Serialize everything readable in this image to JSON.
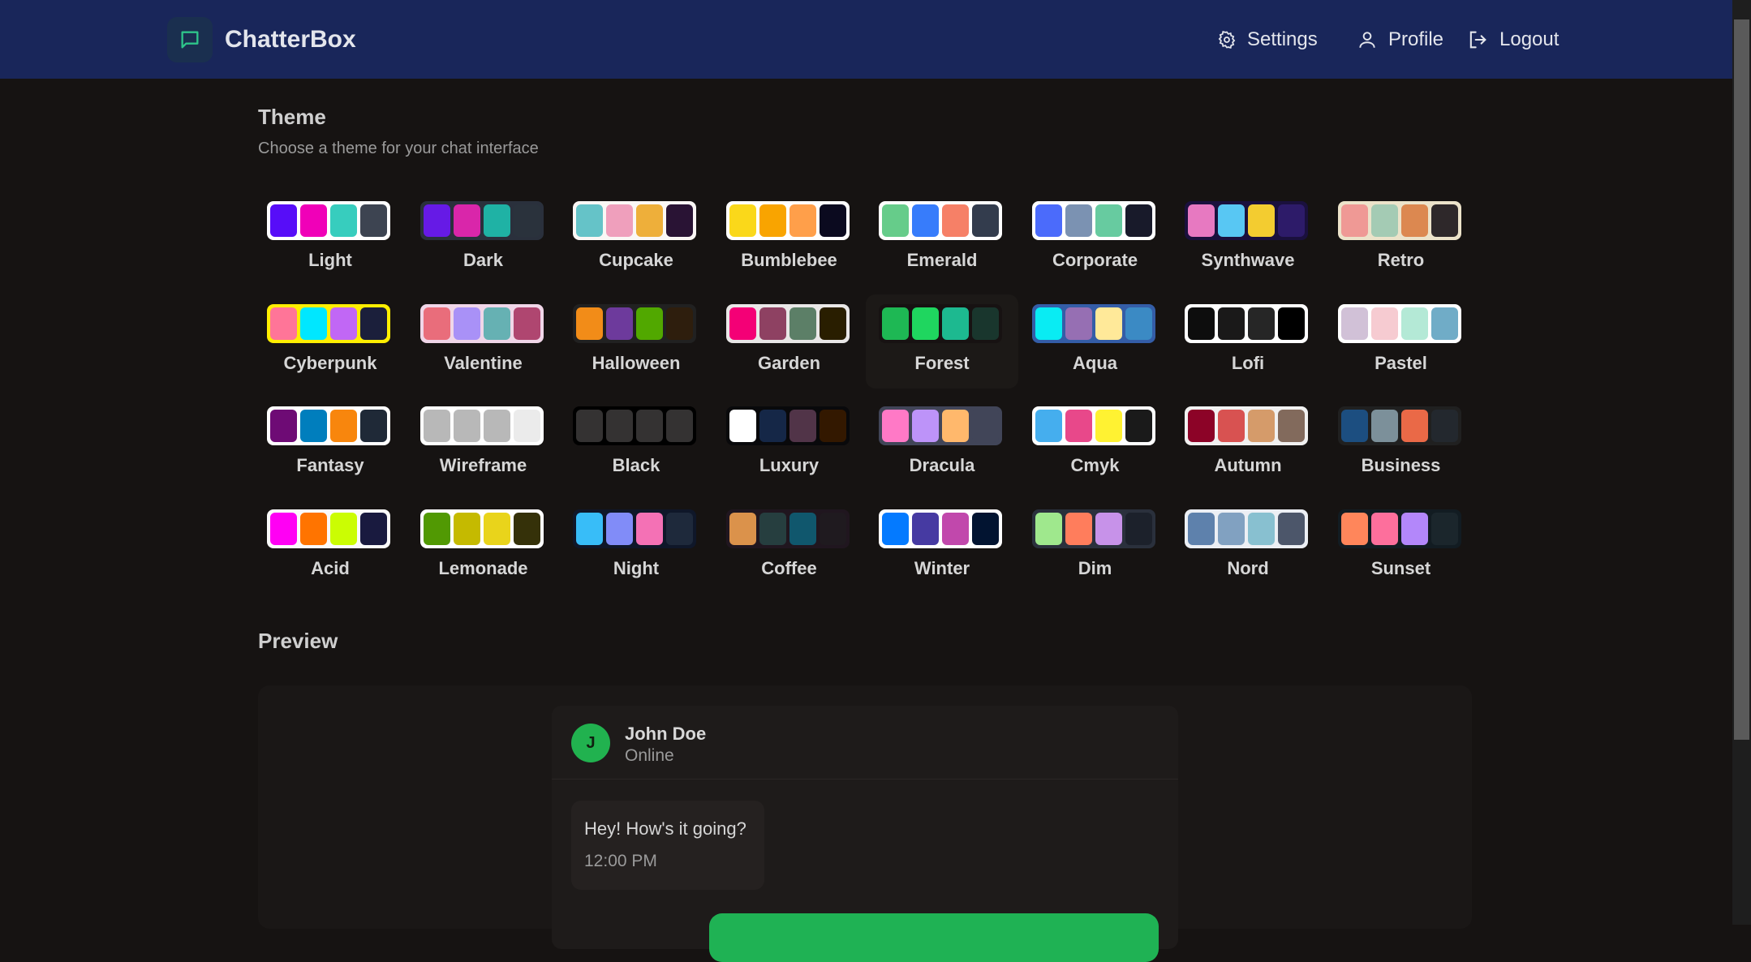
{
  "app": {
    "name": "ChatterBox",
    "accent": "#19265a"
  },
  "nav": {
    "settings": "Settings",
    "profile": "Profile",
    "logout": "Logout"
  },
  "theme_section": {
    "title": "Theme",
    "subtitle": "Choose a theme for your chat interface",
    "active": "Forest",
    "themes": [
      {
        "name": "Light",
        "frame": "#ffffff",
        "colors": [
          "#570df8",
          "#f000b8",
          "#37cdbe",
          "#3d4451"
        ]
      },
      {
        "name": "Dark",
        "frame": "#2a303c",
        "colors": [
          "#661ae6",
          "#d926aa",
          "#1fb2a5",
          "#2a323c"
        ]
      },
      {
        "name": "Cupcake",
        "frame": "#faf7f5",
        "colors": [
          "#65c3c8",
          "#ef9fbc",
          "#eeaf3a",
          "#291334"
        ]
      },
      {
        "name": "Bumblebee",
        "frame": "#ffffff",
        "colors": [
          "#fad81a",
          "#f9a400",
          "#ff9f4a",
          "#0b0a1f"
        ]
      },
      {
        "name": "Emerald",
        "frame": "#ffffff",
        "colors": [
          "#66cc8a",
          "#377cfb",
          "#f68067",
          "#333c4d"
        ]
      },
      {
        "name": "Corporate",
        "frame": "#ffffff",
        "colors": [
          "#4b6bfb",
          "#7b92b2",
          "#67cba0",
          "#181a2a"
        ]
      },
      {
        "name": "Synthwave",
        "frame": "#1a103d",
        "colors": [
          "#e779c1",
          "#58c7f3",
          "#f3cc30",
          "#2d1b69"
        ]
      },
      {
        "name": "Retro",
        "frame": "#ece3ca",
        "colors": [
          "#ef9995",
          "#a4cbb4",
          "#dc8850",
          "#2e282a"
        ]
      },
      {
        "name": "Cyberpunk",
        "frame": "#ffee00",
        "colors": [
          "#ff7598",
          "#00e7ff",
          "#c167f5",
          "#1b1f3b"
        ]
      },
      {
        "name": "Valentine",
        "frame": "#f0d6e8",
        "colors": [
          "#e96d7b",
          "#a991f7",
          "#66b1b3",
          "#af4670"
        ]
      },
      {
        "name": "Halloween",
        "frame": "#212121",
        "colors": [
          "#f28c18",
          "#6d3a9c",
          "#51a800",
          "#2e1e0d"
        ]
      },
      {
        "name": "Garden",
        "frame": "#e9e7e7",
        "colors": [
          "#f40076",
          "#8e4162",
          "#5c7f67",
          "#291e00"
        ]
      },
      {
        "name": "Forest",
        "frame": "#171212",
        "colors": [
          "#1eb854",
          "#1fd65f",
          "#1db990",
          "#19362d"
        ]
      },
      {
        "name": "Aqua",
        "frame": "#345da7",
        "colors": [
          "#09ecf3",
          "#966fb3",
          "#ffe999",
          "#3b8ac4"
        ]
      },
      {
        "name": "Lofi",
        "frame": "#ffffff",
        "colors": [
          "#0d0d0d",
          "#1a1919",
          "#262626",
          "#000000"
        ]
      },
      {
        "name": "Pastel",
        "frame": "#ffffff",
        "colors": [
          "#d1c1d7",
          "#f6cbd1",
          "#b4e9d6",
          "#70acc7"
        ]
      },
      {
        "name": "Fantasy",
        "frame": "#ffffff",
        "colors": [
          "#6e0b75",
          "#007ebd",
          "#f8860d",
          "#1f2937"
        ]
      },
      {
        "name": "Wireframe",
        "frame": "#ffffff",
        "colors": [
          "#b8b8b8",
          "#b8b8b8",
          "#b8b8b8",
          "#ebebeb"
        ]
      },
      {
        "name": "Black",
        "frame": "#000000",
        "colors": [
          "#343232",
          "#343232",
          "#343232",
          "#343232"
        ]
      },
      {
        "name": "Luxury",
        "frame": "#09090b",
        "colors": [
          "#ffffff",
          "#152747",
          "#513448",
          "#331800"
        ]
      },
      {
        "name": "Dracula",
        "frame": "#414558",
        "colors": [
          "#ff79c6",
          "#bd93f9",
          "#ffb86c",
          "#414558"
        ]
      },
      {
        "name": "Cmyk",
        "frame": "#ffffff",
        "colors": [
          "#45aeee",
          "#e8488a",
          "#fff232",
          "#1a1a1a"
        ]
      },
      {
        "name": "Autumn",
        "frame": "#f1f1f1",
        "colors": [
          "#8c0327",
          "#d85251",
          "#d59b6a",
          "#826a5c"
        ]
      },
      {
        "name": "Business",
        "frame": "#202020",
        "colors": [
          "#1c4e80",
          "#7c909a",
          "#ea6947",
          "#23282e"
        ]
      },
      {
        "name": "Acid",
        "frame": "#fafafa",
        "colors": [
          "#ff00f4",
          "#ff7400",
          "#cbfd03",
          "#191a3f"
        ]
      },
      {
        "name": "Lemonade",
        "frame": "#ffffff",
        "colors": [
          "#519903",
          "#c5ba00",
          "#e9d41b",
          "#353109"
        ]
      },
      {
        "name": "Night",
        "frame": "#0f1729",
        "colors": [
          "#38bdf8",
          "#818cf8",
          "#f471b5",
          "#1e293b"
        ]
      },
      {
        "name": "Coffee",
        "frame": "#20161f",
        "colors": [
          "#db924b",
          "#263e3f",
          "#10576d",
          "#1f1a1f"
        ]
      },
      {
        "name": "Winter",
        "frame": "#ffffff",
        "colors": [
          "#047aff",
          "#463aa2",
          "#c148ac",
          "#021431"
        ]
      },
      {
        "name": "Dim",
        "frame": "#2a303c",
        "colors": [
          "#9fe88d",
          "#ff7d5c",
          "#c792e9",
          "#1c212b"
        ]
      },
      {
        "name": "Nord",
        "frame": "#eceff4",
        "colors": [
          "#5e81ac",
          "#81a1c1",
          "#88c0d0",
          "#4c566a"
        ]
      },
      {
        "name": "Sunset",
        "frame": "#121c22",
        "colors": [
          "#ff865b",
          "#fd6f9c",
          "#b387fa",
          "#1b262c"
        ]
      }
    ]
  },
  "preview": {
    "title": "Preview",
    "contact": {
      "initial": "J",
      "name": "John Doe",
      "status": "Online"
    },
    "messages": [
      {
        "text": "Hey! How's it going?",
        "time": "12:00 PM"
      }
    ],
    "colors": {
      "avatar": "#21b24f",
      "outgoing": "#1fb254"
    }
  }
}
